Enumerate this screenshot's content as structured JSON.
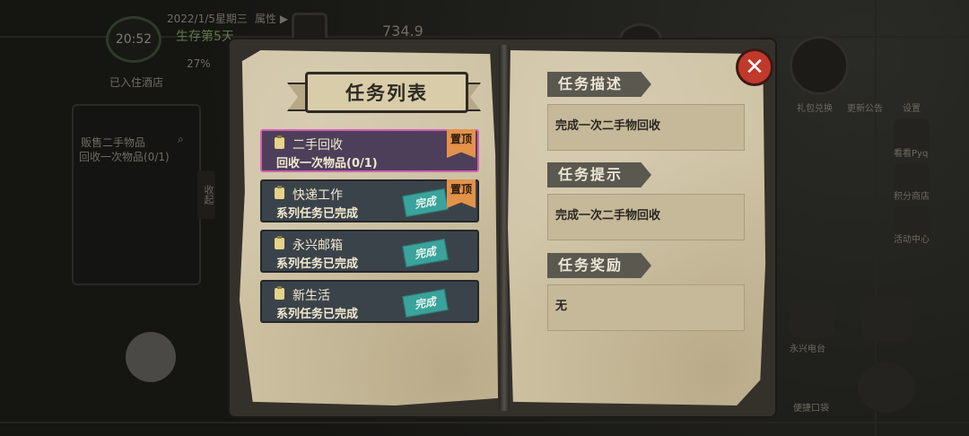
{
  "hud": {
    "clock": "20:52",
    "date": "2022/1/5星期三",
    "attributes_label": "属性 ▶",
    "survival_day": "生存第5天",
    "percent": "27%",
    "location": "已入住酒店",
    "money": "734.9",
    "left_task_title": "贩售二手物品",
    "left_task_progress": "回收一次物品(0/1)",
    "collapse_label": "收起",
    "right_menu": [
      "礼包兑换",
      "更新公告",
      "设置",
      "看看Pyq",
      "积分商店",
      "活动中心",
      "永兴电台",
      "便捷口袋"
    ]
  },
  "dialog": {
    "title": "任务列表",
    "close_symbol": "✕",
    "tasks": [
      {
        "name": "二手回收",
        "desc": "回收一次物品(0/1)",
        "pin": "置顶",
        "stamp": ""
      },
      {
        "name": "快递工作",
        "desc": "系列任务已完成",
        "pin": "置顶",
        "stamp": "完成"
      },
      {
        "name": "永兴邮箱",
        "desc": "系列任务已完成",
        "pin": "",
        "stamp": "完成"
      },
      {
        "name": "新生活",
        "desc": "系列任务已完成",
        "pin": "",
        "stamp": "完成"
      }
    ],
    "sections": [
      {
        "heading": "任务描述",
        "content": "完成一次二手物回收"
      },
      {
        "heading": "任务提示",
        "content": "完成一次二手物回收"
      },
      {
        "heading": "任务奖励",
        "content": "无"
      }
    ]
  },
  "colors": {
    "selected_border": "#d45fb3",
    "pin": "#e3924a",
    "stamp": "#3aa39c",
    "close": "#c0392b"
  }
}
